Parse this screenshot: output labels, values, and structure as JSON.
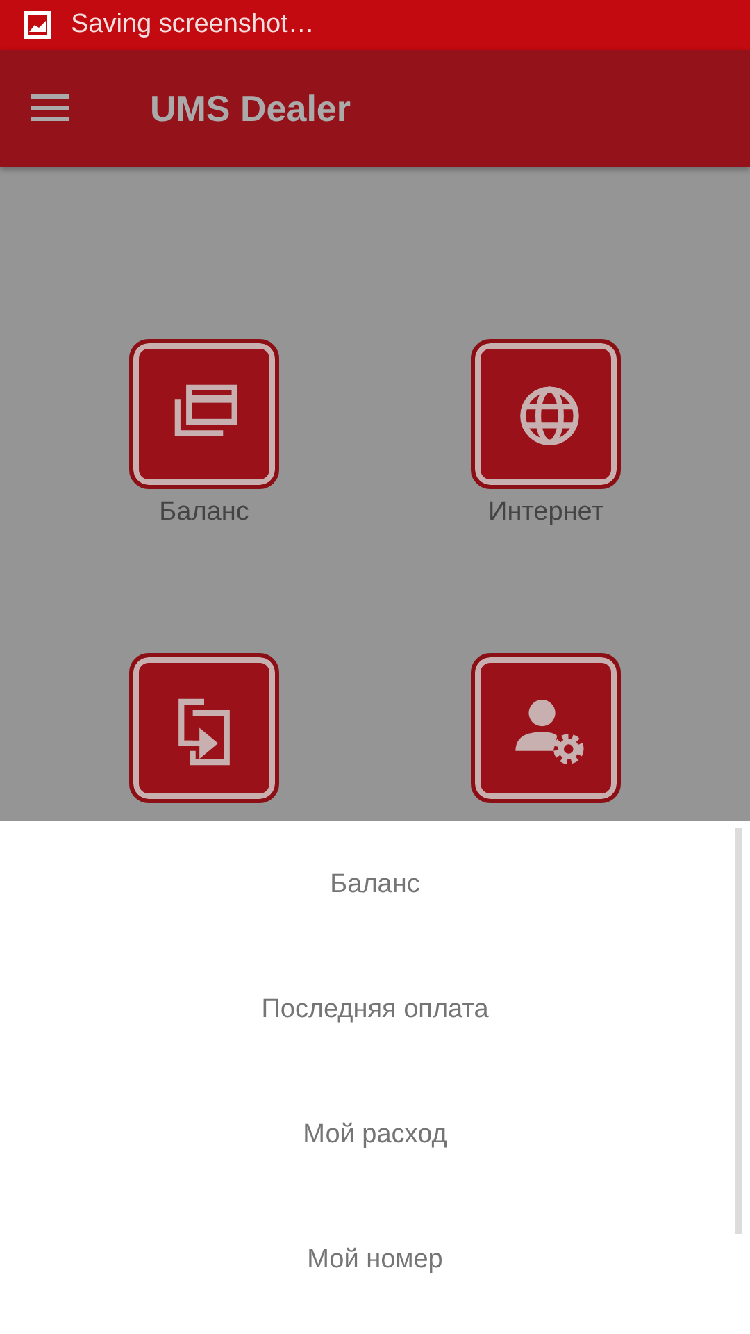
{
  "status_bar": {
    "text": "Saving screenshot…"
  },
  "app_bar": {
    "title": "UMS Dealer"
  },
  "tiles": [
    {
      "kind": "cards",
      "label": "Баланс"
    },
    {
      "kind": "globe",
      "label": "Интернет"
    },
    {
      "kind": "swap"
    },
    {
      "kind": "user-settings"
    }
  ],
  "sheet": {
    "items": [
      "Баланс",
      "Последняя оплата",
      "Мой расход",
      "Мой номер"
    ]
  }
}
